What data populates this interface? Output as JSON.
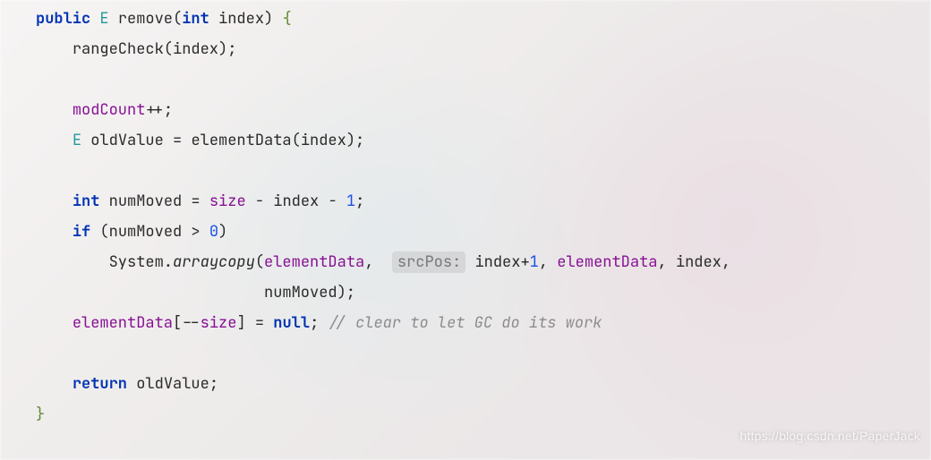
{
  "code": {
    "kw_public": "public",
    "type_E": "E",
    "method_remove": "remove",
    "kw_int": "int",
    "param_index": "index",
    "lbrace": "{",
    "rbrace": "}",
    "call_rangeCheck": "rangeCheck(index);",
    "modCount": "modCount",
    "plusplus_semi": "++;",
    "decl_E": "E",
    "var_oldValue": "oldValue",
    "eq": " = ",
    "call_elementData": "elementData(index);",
    "kw_int2": "int",
    "var_numMoved": "numMoved",
    "size": "size",
    "minus_index_minus": " - index - ",
    "one": "1",
    "semi": ";",
    "kw_if": "if",
    "cond_open": " (numMoved > ",
    "zero": "0",
    "cond_close": ")",
    "System_dot": "System.",
    "arraycopy": "arraycopy",
    "open_paren": "(",
    "elementData": "elementData",
    "comma_sp": ", ",
    "hint_srcPos": "srcPos:",
    "sp_indexplus": " index+",
    "one2": "1",
    "comma_sp2": ", ",
    "comma_index_comma": ", index,",
    "cont_numMoved": "numMoved);",
    "bracket_open": "[--",
    "bracket_close": "] = ",
    "kw_null": "null",
    "semi2": ";",
    "comment": "// clear to let GC do its work",
    "kw_return": "return",
    "ret_val": " oldValue;"
  },
  "watermark": "https://blog.csdn.net/PaperJack"
}
